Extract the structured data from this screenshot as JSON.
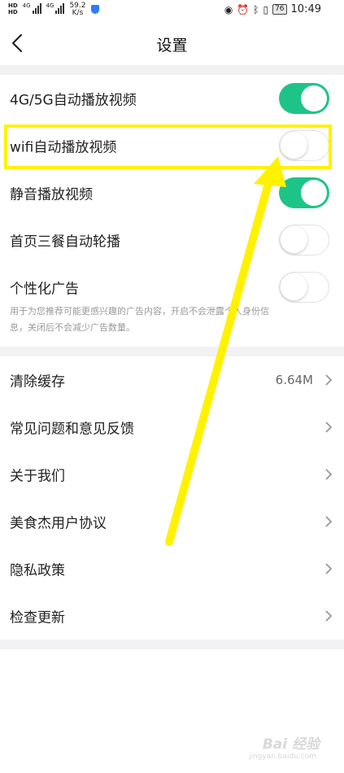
{
  "status_bar": {
    "speed_value": "59.2",
    "speed_unit": "K/s",
    "net1": "4G",
    "net2": "4G",
    "battery": "76",
    "time": "10:49"
  },
  "header": {
    "title": "设置"
  },
  "toggles": [
    {
      "label": "4G/5G自动播放视频",
      "on": true
    },
    {
      "label": "wifi自动播放视频",
      "on": false
    },
    {
      "label": "静音播放视频",
      "on": true
    },
    {
      "label": "首页三餐自动轮播",
      "on": false
    },
    {
      "label": "个性化广告",
      "on": false
    }
  ],
  "ad_description": "用于为您推荐可能更感兴趣的广告内容，开启不会泄露个人身份信息，关闭后不会减少广告数量。",
  "nav_items": [
    {
      "label": "清除缓存",
      "value": "6.64M"
    },
    {
      "label": "常见问题和意见反馈"
    },
    {
      "label": "关于我们"
    },
    {
      "label": "美食杰用户协议"
    },
    {
      "label": "隐私政策"
    },
    {
      "label": "检查更新"
    }
  ],
  "colors": {
    "toggle_on": "#1ec487",
    "highlight": "#fff200",
    "arrow": "#fff200"
  },
  "watermark": {
    "logo_text": "Bai 经验",
    "url": "jingyan.baidu.com"
  }
}
